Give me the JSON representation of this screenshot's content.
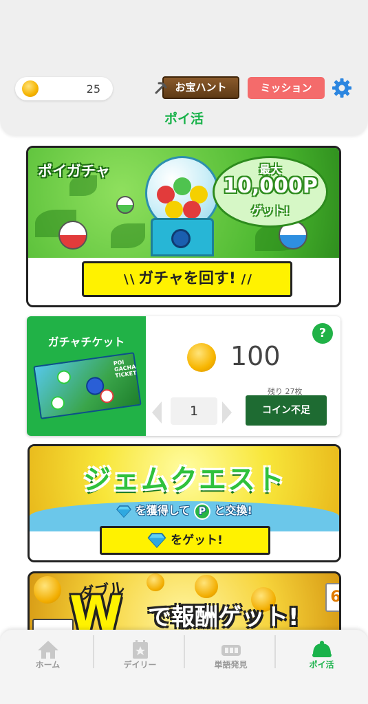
{
  "header": {
    "coin_count": "25",
    "treasure_label": "お宝ハント",
    "mission_label": "ミッション",
    "page_title": "ポイ活"
  },
  "gacha": {
    "title": "ポイガチャ",
    "bubble_line1": "最大",
    "bubble_line2": "10,000P",
    "bubble_line3": "ゲット!",
    "spin_label": "ガチャを回す!"
  },
  "ticket": {
    "label": "ガチャチケット",
    "ticket_art_text": "POI GACHA TICKET",
    "help": "?",
    "price": "100",
    "quantity": "1",
    "remaining": "残り 27枚",
    "insufficient": "コイン不足"
  },
  "gem_quest": {
    "title": "ジェムクエスト",
    "sub_part1": "を獲得して",
    "sub_p": "P",
    "sub_part2": "と交換!",
    "button_label": "をゲット!"
  },
  "double": {
    "small": "ダブル",
    "w": "W",
    "text": "で報酬ゲット!",
    "card_number": "6"
  },
  "nav": {
    "items": [
      {
        "label": "ホーム",
        "icon": "home-icon",
        "active": false
      },
      {
        "label": "デイリー",
        "icon": "daily-icon",
        "active": false
      },
      {
        "label": "単語発見",
        "icon": "words-icon",
        "active": false
      },
      {
        "label": "ポイ活",
        "icon": "poikatsu-icon",
        "active": true
      }
    ]
  },
  "colors": {
    "accent_green": "#19b24a",
    "mission_red": "#f46b6b",
    "button_yellow": "#fff200"
  }
}
